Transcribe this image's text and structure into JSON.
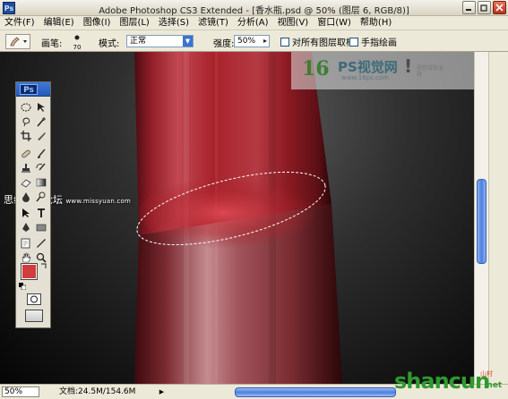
{
  "window": {
    "app_icon_label": "Ps",
    "title": "Adobe Photoshop CS3 Extended - [香水瓶.psd @ 50% (图层 6, RGB/8)]"
  },
  "menu": [
    "文件(F)",
    "编辑(E)",
    "图像(I)",
    "图层(L)",
    "选择(S)",
    "滤镜(T)",
    "分析(A)",
    "视图(V)",
    "窗口(W)",
    "帮助(H)"
  ],
  "options": {
    "brush_label": "画笔:",
    "brush_size": "70",
    "mode_label": "模式:",
    "mode_value": "正常",
    "strength_label": "强度:",
    "strength_value": "50%",
    "sample_all_layers": "对所有图层取样",
    "finger_painting": "手指绘画"
  },
  "toolbox": {
    "header_label": "Ps",
    "foreground_color": "#d23c3c",
    "background_color": "#000000"
  },
  "watermark": {
    "logo": "16",
    "name": "PS视觉网",
    "url": "www.16ps.com",
    "slogan": "视觉成就无限"
  },
  "side_watermark": {
    "text": "思缘设计论坛",
    "url": "www.missyuan.com"
  },
  "status": {
    "zoom": "50%",
    "doc_info": "文档:24.5M/154.6M"
  },
  "corner_logo": {
    "text": "shancun",
    "net": ".net",
    "tag": "山村"
  },
  "colors": {
    "bottle_red": "#a8222b",
    "canvas_bg": "#1a1a1a",
    "scroll_blue": "#4a7fe0"
  }
}
